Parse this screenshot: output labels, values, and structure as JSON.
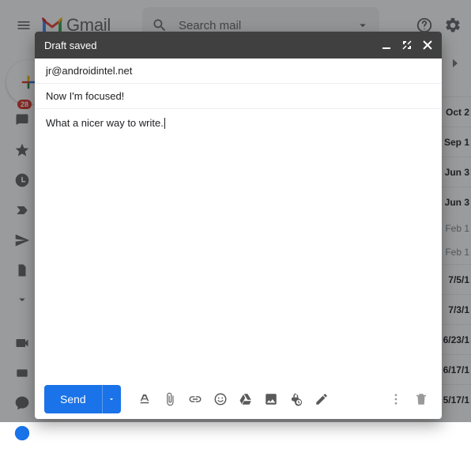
{
  "header": {
    "logo_text": "Gmail",
    "search_placeholder": "Search mail"
  },
  "sidebar": {
    "badge": "28"
  },
  "dates": [
    {
      "text": "Oct 2",
      "bold": true
    },
    {
      "text": "Sep 1",
      "bold": true
    },
    {
      "text": "Jun 3",
      "bold": true
    },
    {
      "text": "Jun 3",
      "bold": true
    },
    {
      "text": "Feb 1",
      "bold": false,
      "light": true
    },
    {
      "text": "Feb 1",
      "bold": false,
      "light": true
    },
    {
      "text": "7/5/1",
      "bold": true
    },
    {
      "text": "7/3/1",
      "bold": true
    },
    {
      "text": "6/23/1",
      "bold": true
    },
    {
      "text": "6/17/1",
      "bold": true
    },
    {
      "text": "5/17/1",
      "bold": true
    }
  ],
  "compose": {
    "title": "Draft saved",
    "to": "jr@androidintel.net",
    "subject": "Now I'm focused!",
    "body": "What a nicer way to write.",
    "send_label": "Send"
  }
}
